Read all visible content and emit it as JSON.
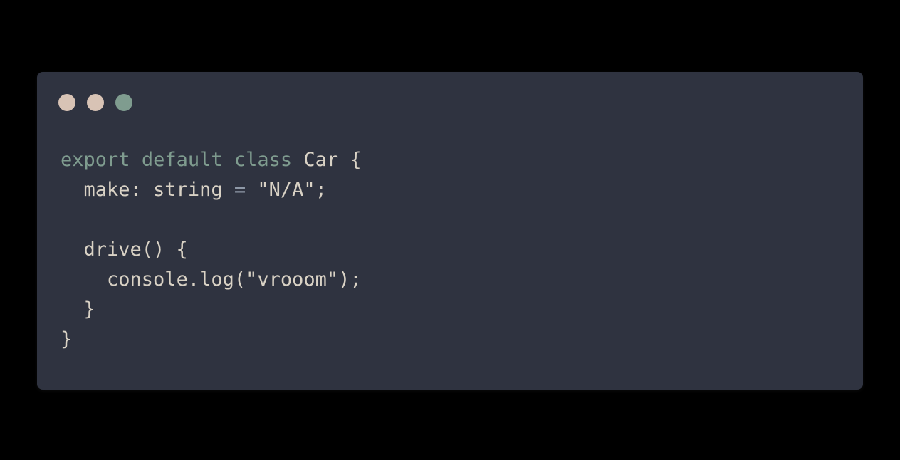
{
  "window": {
    "buttons": [
      {
        "name": "close",
        "color": "#d8c3b5"
      },
      {
        "name": "minimize",
        "color": "#d8c3b5"
      },
      {
        "name": "maximize",
        "color": "#7f9c8f"
      }
    ]
  },
  "code": {
    "lines": [
      {
        "indent": "",
        "kw1": "export",
        "kw2": "default",
        "kw3": "class",
        "rest": " Car {"
      },
      {
        "indent": "  ",
        "text": "make: string ",
        "eq": "=",
        "rest": " \"N/A\";"
      },
      {
        "indent": "",
        "text": ""
      },
      {
        "indent": "  ",
        "text": "drive() {"
      },
      {
        "indent": "    ",
        "text": "console.log(\"vrooom\");"
      },
      {
        "indent": "  ",
        "text": "}"
      },
      {
        "indent": "",
        "text": "}"
      }
    ]
  },
  "colors": {
    "background": "#000000",
    "window": "#2f3340",
    "keyword": "#7f9c8f",
    "text": "#d9d2c5"
  }
}
